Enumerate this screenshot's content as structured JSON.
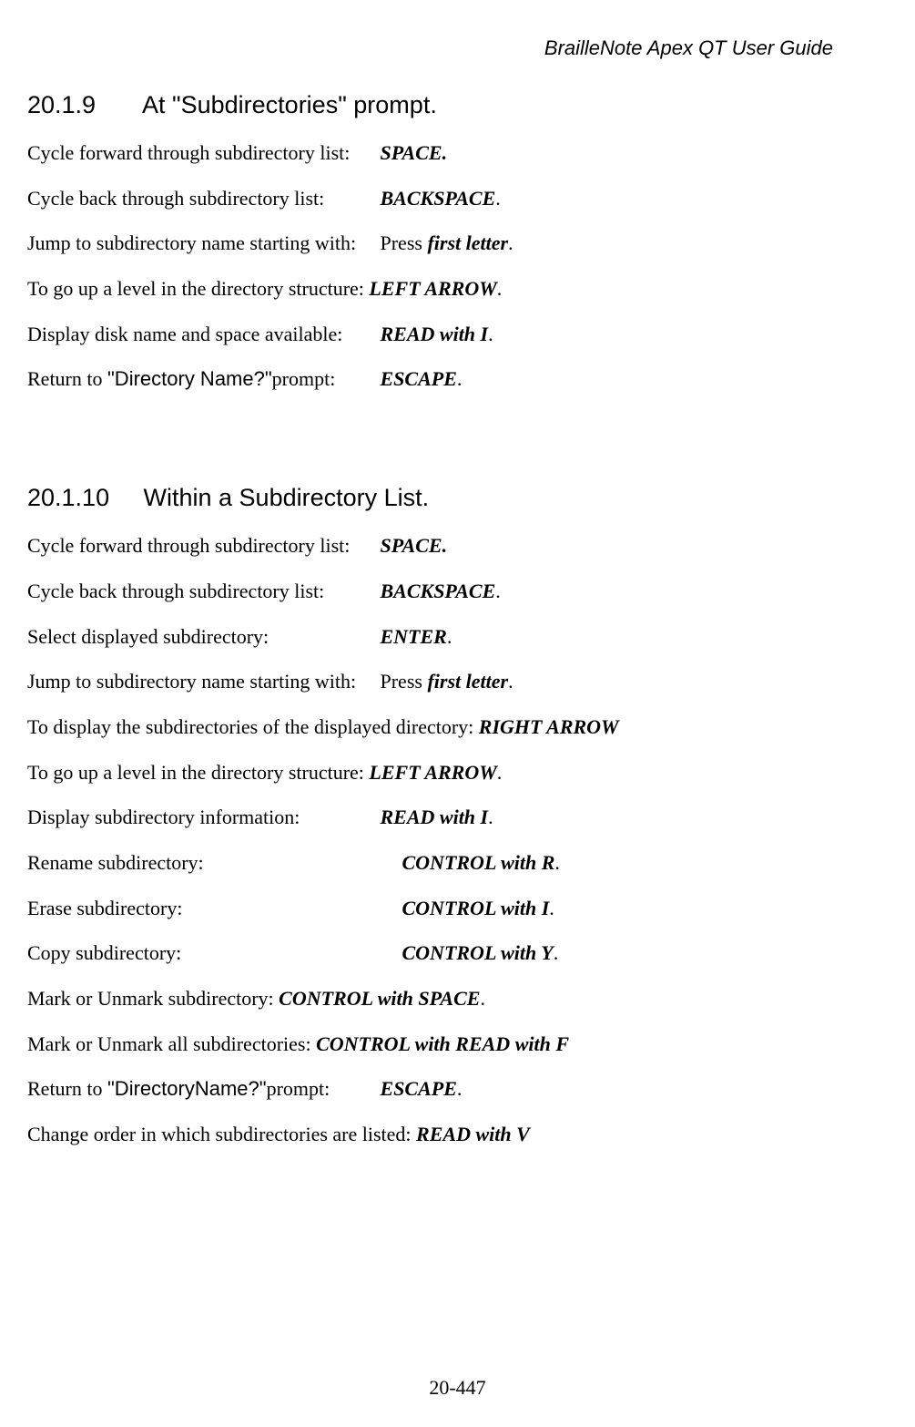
{
  "header": "BrailleNote Apex QT User Guide",
  "footer": "20-447",
  "s1": {
    "num": "20.1.9",
    "title": "At \"Subdirectories\" prompt.",
    "r1d": "Cycle forward through subdirectory list:",
    "r1k": "SPACE.",
    "r2d": "Cycle back through subdirectory list:",
    "r2k": "BACKSPACE",
    "r3d": "Jump to subdirectory name starting with:",
    "r3p": "Press ",
    "r3k": "first letter",
    "r4d": "To go up a level in the directory structure: ",
    "r4k": "LEFT ARROW",
    "r5d": "Display disk name and space available:",
    "r5k": "READ with I",
    "r6a": "Return to ",
    "r6b": "\"Directory Name?\"",
    "r6c": "prompt:",
    "r6k": "ESCAPE"
  },
  "s2": {
    "num": "20.1.10",
    "title": "Within a Subdirectory List.",
    "r1d": "Cycle forward through subdirectory list:",
    "r1k": "SPACE.",
    "r2d": "Cycle back through subdirectory list:",
    "r2k": "BACKSPACE",
    "r3d": "Select displayed subdirectory:",
    "r3k": "ENTER",
    "r4d": "Jump to subdirectory name starting with:",
    "r4p": "Press ",
    "r4k": "first letter",
    "r5d": "To display the subdirectories of the displayed directory: ",
    "r5k": "RIGHT ARROW",
    "r6d": "To go up a level in the directory structure: ",
    "r6k": "LEFT ARROW",
    "r7d": "Display subdirectory information:",
    "r7k": "READ with I",
    "r8d": "Rename subdirectory:",
    "r8k": "CONTROL with R",
    "r9d": "Erase subdirectory:",
    "r9k": "CONTROL with I",
    "r10d": "Copy subdirectory:",
    "r10k": "CONTROL with Y",
    "r11d": "Mark or Unmark subdirectory: ",
    "r11k": "CONTROL with SPACE",
    "r12d": "Mark or Unmark all subdirectories: ",
    "r12k": "CONTROL with READ with F",
    "r13a": "Return to ",
    "r13b": "\"DirectoryName?\"",
    "r13c": "prompt:",
    "r13k": "ESCAPE",
    "r14d": "Change order in which subdirectories are listed: ",
    "r14k": "READ with V"
  }
}
